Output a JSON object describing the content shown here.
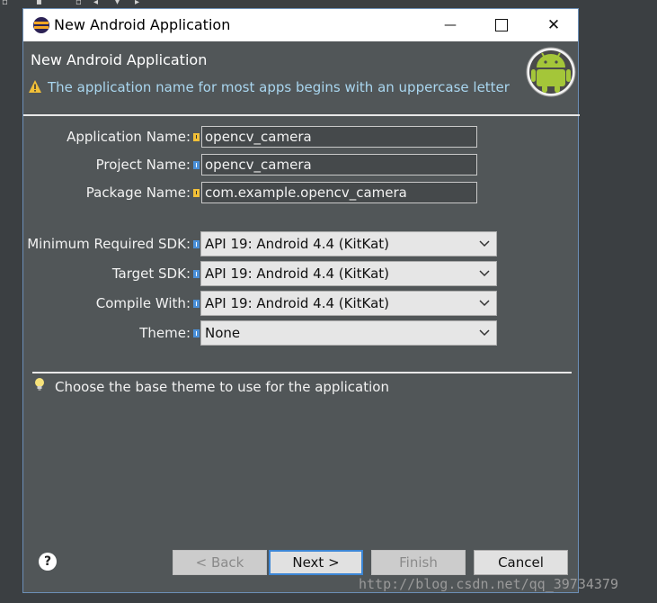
{
  "window": {
    "title": "New Android Application",
    "minimize_glyph": "—",
    "close_glyph": "✕"
  },
  "header": {
    "page_title": "New Android Application",
    "warning_message": "The application name for most apps begins with an uppercase letter",
    "warning_color": "#a9d6ef"
  },
  "form": {
    "app_name_label": "Application Name:",
    "app_name_value": "opencv_camera",
    "project_name_label": "Project Name:",
    "project_name_value": "opencv_camera",
    "package_name_label": "Package Name:",
    "package_name_value": "com.example.opencv_camera",
    "min_sdk_label": "Minimum Required SDK:",
    "min_sdk_value": "API 19: Android 4.4 (KitKat)",
    "target_sdk_label": "Target SDK:",
    "target_sdk_value": "API 19: Android 4.4 (KitKat)",
    "compile_with_label": "Compile With:",
    "compile_with_value": "API 19: Android 4.4 (KitKat)",
    "theme_label": "Theme:",
    "theme_value": "None"
  },
  "hint": {
    "text": "Choose the base theme to use for the application"
  },
  "buttons": {
    "help": "?",
    "back": "< Back",
    "next": "Next >",
    "finish": "Finish",
    "cancel": "Cancel"
  },
  "watermark": "http://blog.csdn.net/qq_39734379",
  "icons": {
    "app": "eclipse-icon",
    "warning": "warning-icon",
    "flag_warning": "warning-flag-icon",
    "flag_info": "info-flag-icon",
    "hint": "lightbulb-icon",
    "logo": "android-logo"
  },
  "colors": {
    "dialog_bg": "#515658",
    "accent_blue": "#3c86d6",
    "warning_flag": "#f2c037",
    "info_flag": "#4a90d9"
  }
}
